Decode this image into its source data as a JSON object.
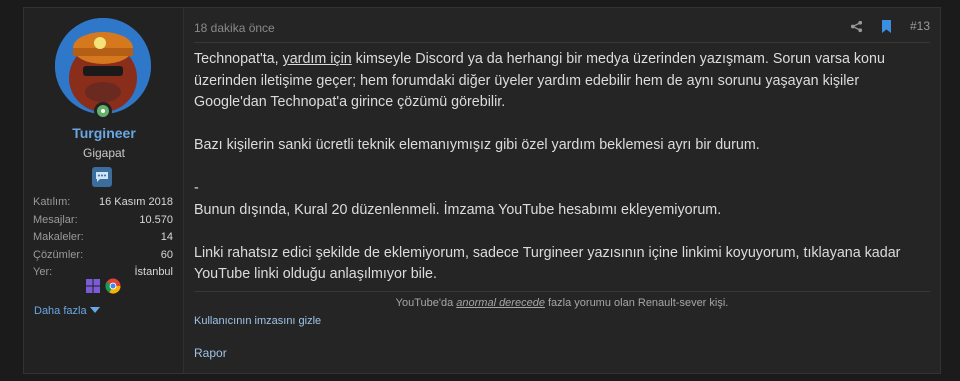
{
  "post": {
    "time_ago": "18 dakika önce",
    "number": "#13",
    "user": {
      "name": "Turgineer",
      "title": "Gigapat",
      "stats": [
        {
          "label": "Katılım:",
          "value": "16 Kasım 2018"
        },
        {
          "label": "Mesajlar:",
          "value": "10.570"
        },
        {
          "label": "Makaleler:",
          "value": "14"
        },
        {
          "label": "Çözümler:",
          "value": "60"
        },
        {
          "label": "Yer:",
          "value": "İstanbul"
        }
      ],
      "more_label": "Daha fazla"
    },
    "body": {
      "p1_before": "Technopat'ta, ",
      "p1_link": "yardım için",
      "p1_after": " kimseyle Discord ya da herhangi bir medya üzerinden yazışmam. Sorun varsa konu üzerinden iletişime geçer; hem forumdaki diğer üyeler yardım edebilir hem de aynı sorunu yaşayan kişiler Google'dan Technopat'a girince çözümü görebilir.",
      "p2": "Bazı kişilerin sanki ücretli teknik elemanıymışız gibi özel yardım beklemesi ayrı bir durum.",
      "p3_dash": "-",
      "p3": "Bunun dışında, Kural 20 düzenlenmeli. İmzama YouTube hesabımı ekleyemiyorum.",
      "p4": "Linki rahatsız edici şekilde de eklemiyorum, sadece Turgineer yazısının içine linkimi koyuyorum, tıklayana kadar YouTube linki olduğu anlaşılmıyor bile."
    },
    "signature": {
      "before": "YouTube'da ",
      "emph": "anormal derecede",
      "after": " fazla yorumu olan Renault-sever kişi."
    },
    "hide_signature_label": "Kullanıcının imzasını gizle",
    "report_label": "Rapor"
  },
  "colors": {
    "page_bg": "#1b1b1b",
    "card_bg": "#252525",
    "username": "#6aa7e3",
    "link": "#9fc3e8",
    "online": "#63b06a"
  }
}
